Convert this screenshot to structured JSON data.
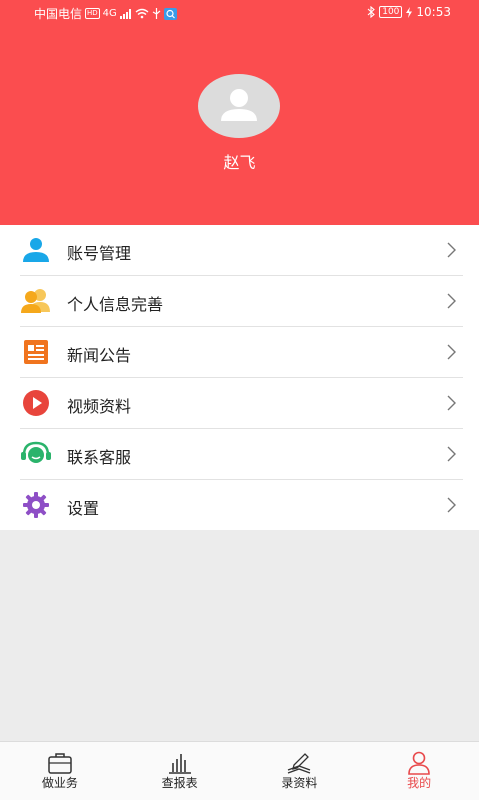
{
  "status_bar": {
    "carrier": "中国电信",
    "hd": "HD",
    "network": "4G",
    "battery": "100",
    "time": "10:53"
  },
  "profile": {
    "username": "赵飞"
  },
  "menu": {
    "items": [
      {
        "label": "账号管理",
        "icon": "user-icon",
        "color": "#19a7e8"
      },
      {
        "label": "个人信息完善",
        "icon": "users-icon",
        "color": "#f5b21b"
      },
      {
        "label": "新闻公告",
        "icon": "news-icon",
        "color": "#f0741e"
      },
      {
        "label": "视频资料",
        "icon": "play-icon",
        "color": "#e8453c"
      },
      {
        "label": "联系客服",
        "icon": "headset-icon",
        "color": "#2ab36b"
      },
      {
        "label": "设置",
        "icon": "gear-icon",
        "color": "#8e4fc6"
      }
    ]
  },
  "tabbar": {
    "tabs": [
      {
        "label": "做业务",
        "icon": "briefcase-icon"
      },
      {
        "label": "查报表",
        "icon": "bar-chart-icon"
      },
      {
        "label": "录资料",
        "icon": "edit-book-icon"
      },
      {
        "label": "我的",
        "icon": "person-icon",
        "active": true
      }
    ]
  },
  "colors": {
    "header": "#fb4d4f",
    "active_tab": "#e8494b"
  }
}
